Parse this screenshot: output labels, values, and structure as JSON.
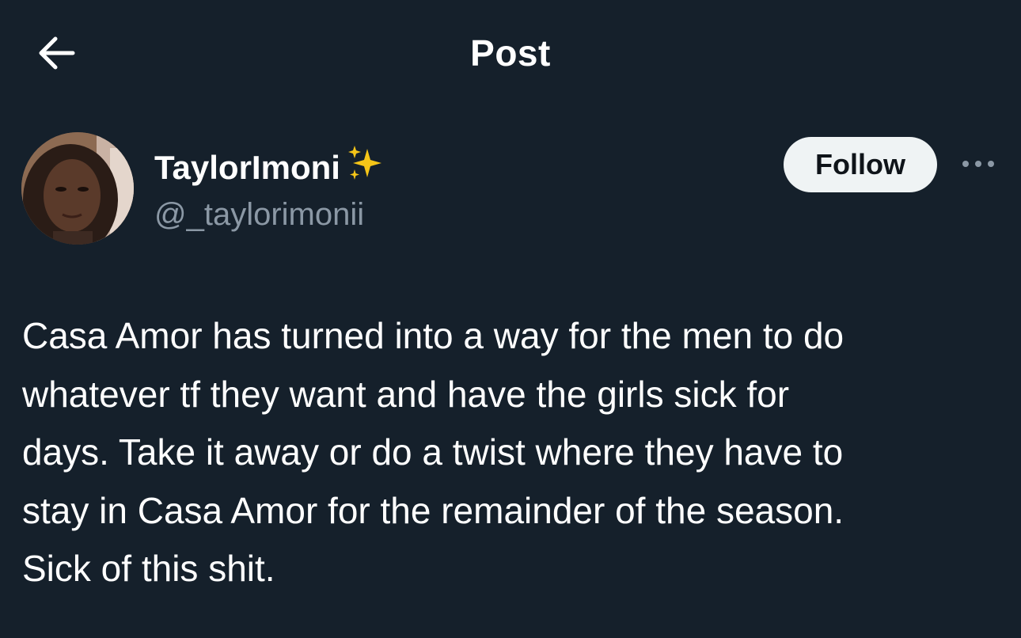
{
  "header": {
    "title": "Post",
    "back_icon": "arrow-left-icon"
  },
  "author": {
    "display_name": "TaylorImoni",
    "name_emoji": "sparkles-icon",
    "handle": "@_taylorimonii",
    "avatar": "avatar-photo"
  },
  "actions": {
    "follow_label": "Follow",
    "more_icon": "more-horizontal-icon"
  },
  "post": {
    "lines": [
      "Casa Amor has turned into a way for the men to do",
      "whatever tf they want and have the girls sick for",
      "days. Take it away or do a twist where they have to",
      "stay in Casa Amor for the remainder of the season.",
      "Sick of this shit."
    ]
  },
  "colors": {
    "background": "#15202b",
    "text_primary": "#ffffff",
    "text_secondary": "#8b98a5",
    "follow_button_bg": "#eff3f4",
    "follow_button_text": "#0f1419",
    "sparkle": "#f5c518"
  }
}
